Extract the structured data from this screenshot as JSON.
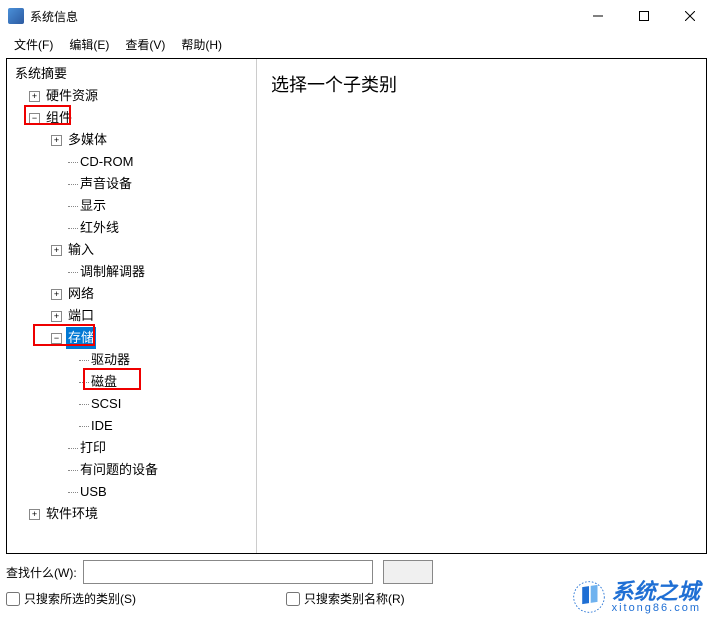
{
  "window": {
    "title": "系统信息"
  },
  "menu": {
    "file": "文件(F)",
    "edit": "编辑(E)",
    "view": "查看(V)",
    "help": "帮助(H)"
  },
  "tree": {
    "summary": "系统摘要",
    "hardware": "硬件资源",
    "components": "组件",
    "multimedia": "多媒体",
    "cdrom": "CD-ROM",
    "sound": "声音设备",
    "display": "显示",
    "infrared": "红外线",
    "input": "输入",
    "modem": "调制解调器",
    "network": "网络",
    "ports": "端口",
    "storage": "存储",
    "drives": "驱动器",
    "disks": "磁盘",
    "scsi": "SCSI",
    "ide": "IDE",
    "printing": "打印",
    "problem_devices": "有问题的设备",
    "usb": "USB",
    "software_env": "软件环境"
  },
  "detail": {
    "prompt": "选择一个子类别"
  },
  "search": {
    "label": "查找什么(W):",
    "value": "",
    "only_selected": "只搜索所选的类别(S)",
    "only_names": "只搜索类别名称(R)"
  },
  "watermark": {
    "cn": "系统之城",
    "en": "xitong86.com"
  }
}
